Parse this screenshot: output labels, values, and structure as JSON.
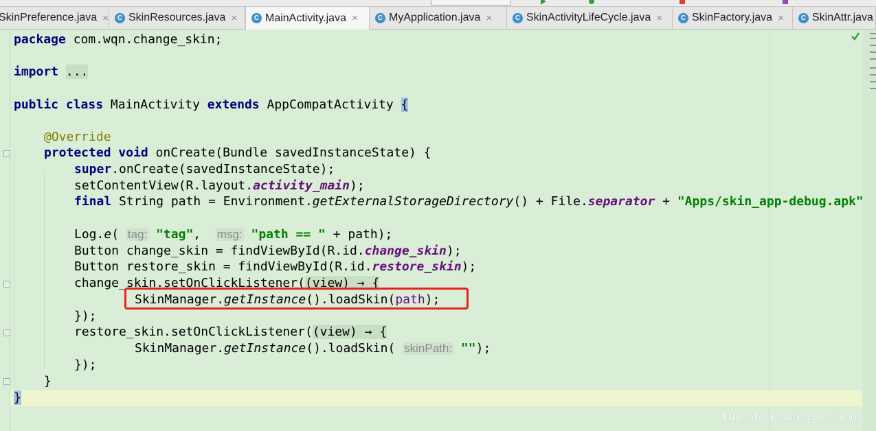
{
  "tabs": [
    {
      "label": "SkinPreference.java",
      "active": false
    },
    {
      "label": "SkinResources.java",
      "active": false
    },
    {
      "label": "MainActivity.java",
      "active": true
    },
    {
      "label": "MyApplication.java",
      "active": false
    },
    {
      "label": "SkinActivityLifeCycle.java",
      "active": false
    },
    {
      "label": "SkinFactory.java",
      "active": false
    },
    {
      "label": "SkinAttr.java",
      "active": false
    }
  ],
  "tab_icon_letter": "C",
  "tab_close_glyph": "×",
  "code": {
    "package_kw": "package",
    "package_name": " com.wqn.change_skin;",
    "import_kw": "import",
    "import_fold": "...",
    "class_public": "public",
    "class_kw": "class",
    "class_name": " MainActivity ",
    "extends_kw": "extends",
    "super_class": " AppCompatActivity ",
    "open_brace": "{",
    "annotation": "@Override",
    "protected_kw": "protected",
    "void_kw": "void",
    "oncreate_sig": " onCreate(Bundle savedInstanceState) {",
    "super_kw": "super",
    "super_call": ".onCreate(savedInstanceState);",
    "setcontent_a": "setContentView(R.layout.",
    "setcontent_field": "activity_main",
    "setcontent_b": ");",
    "final_kw": "final",
    "path_a": " String path = Environment.",
    "path_method": "getExternalStorageDirectory",
    "path_b": "() + File.",
    "path_field": "separator",
    "path_c": " + ",
    "path_str": "\"Apps/skin_app-debug.apk\"",
    "log_a": "Log.",
    "log_method": "e",
    "log_b": "( ",
    "log_hint_tag": "tag:",
    "log_str_tag": "\"tag\"",
    "log_c": ",  ",
    "log_hint_msg": "msg:",
    "log_str_msg": "\"path == \"",
    "log_d": " + path);",
    "btn_change_a": "Button change_skin = findViewById(R.id.",
    "btn_change_field": "change_skin",
    "btn_change_b": ");",
    "btn_restore_a": "Button restore_skin = findViewById(R.id.",
    "btn_restore_field": "restore_skin",
    "btn_restore_b": ");",
    "change_listener_a": "change_skin.setOnClickListener(",
    "change_listener_lambda": "(view) → {",
    "load_a": "SkinManager.",
    "load_method": "getInstance",
    "load_b": "().loadSkin(",
    "load_param": "path",
    "load_c": ");",
    "close_listener_1": "});",
    "restore_listener_a": "restore_skin.setOnClickListener(",
    "restore_listener_lambda": "(view) → {",
    "load2_a": "SkinManager.",
    "load2_method": "getInstance",
    "load2_b": "().loadSkin( ",
    "load2_hint": "skinPath:",
    "load2_str": " \"\"",
    "load2_c": ");",
    "close_listener_2": "});",
    "method_close": "}",
    "class_close": "}"
  },
  "watermark": "https://blog.csdn.net/mr_hmgo",
  "colors": {
    "editor_bg": "#d9edd7",
    "keyword": "#000080",
    "string": "#008000",
    "field": "#660e7a",
    "annotation": "#808000",
    "highlight_box": "#e8231b"
  }
}
